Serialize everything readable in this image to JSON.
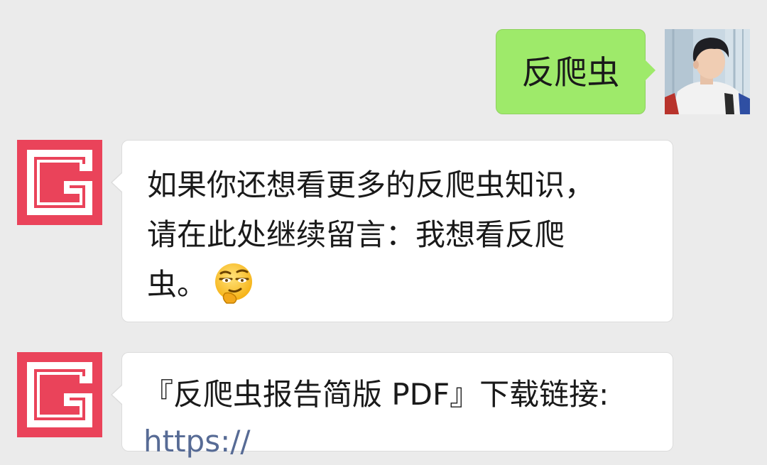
{
  "conversation": {
    "messages": [
      {
        "sender": "user",
        "text": "反爬虫"
      },
      {
        "sender": "bot",
        "text": "如果你还想看更多的反爬虫知识，\n请在此处继续留言：我想看反爬\n虫。",
        "emoji": "thinking-smirk-emoji"
      },
      {
        "sender": "bot",
        "text": "『反爬虫报告简版 PDF』下载链接:",
        "link": "https://"
      }
    ]
  },
  "colors": {
    "background": "#ebebeb",
    "outgoing_bubble": "#9eea6a",
    "incoming_bubble": "#ffffff",
    "bot_avatar": "#ea435a",
    "link": "#576b95"
  },
  "icons": {
    "bot_avatar": "g-logo-icon",
    "user_avatar": "user-photo-avatar"
  }
}
